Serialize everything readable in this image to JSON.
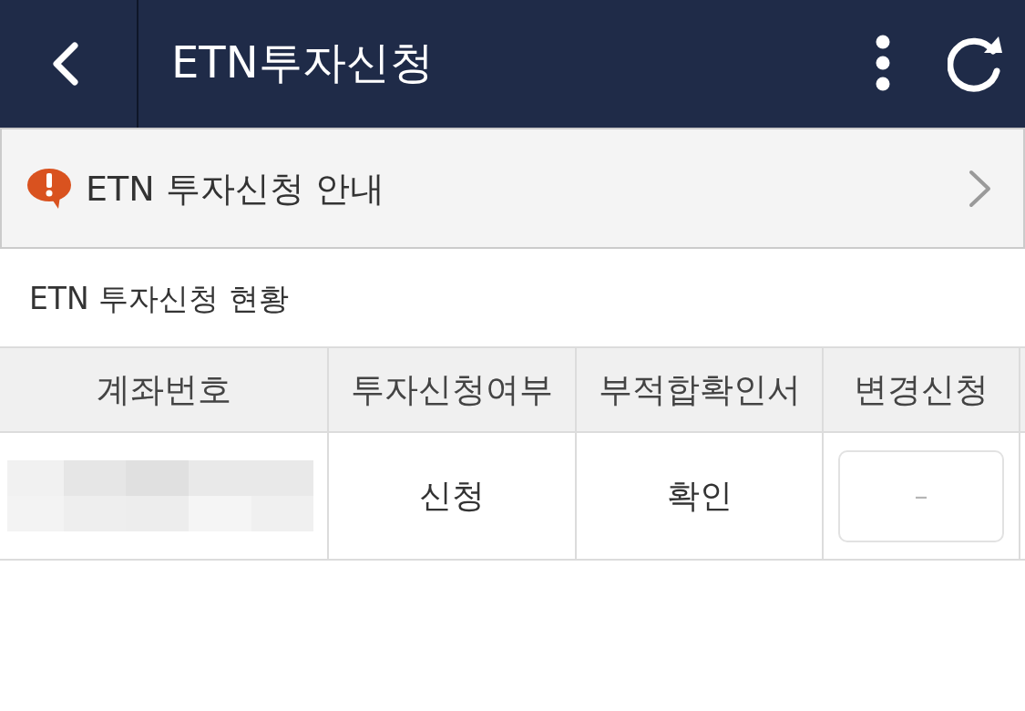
{
  "header": {
    "title": "ETN투자신청"
  },
  "notice": {
    "text": "ETN 투자신청 안내"
  },
  "section": {
    "title": "ETN 투자신청 현황"
  },
  "table": {
    "columns": [
      "계좌번호",
      "투자신청여부",
      "부적합확인서",
      "변경신청"
    ],
    "rows": [
      {
        "application_status": "신청",
        "unsuitability_confirmation": "확인",
        "change_button": "–"
      }
    ]
  }
}
